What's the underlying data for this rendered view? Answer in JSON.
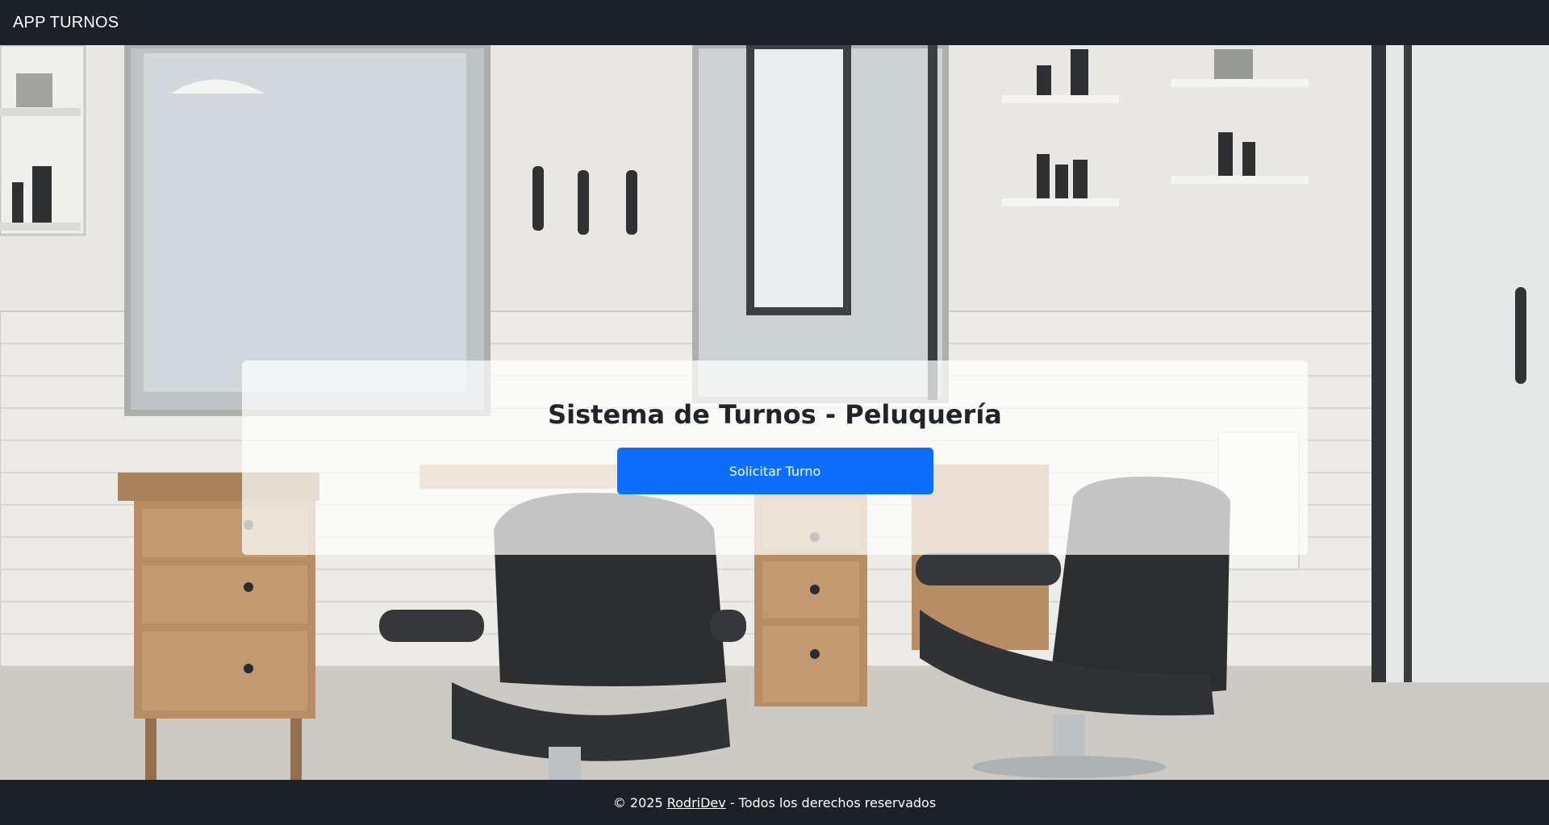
{
  "navbar": {
    "brand": "APP TURNOS"
  },
  "hero": {
    "title": "Sistema de Turnos - Peluquería",
    "cta_label": "Solicitar Turno"
  },
  "footer": {
    "prefix": "© 2025 ",
    "author_link": "RodriDev",
    "suffix": " - Todos los derechos reservados"
  },
  "colors": {
    "navbar_bg": "#1c2127",
    "primary_button": "#0d6efd",
    "card_overlay": "rgba(255,255,255,0.72)"
  }
}
